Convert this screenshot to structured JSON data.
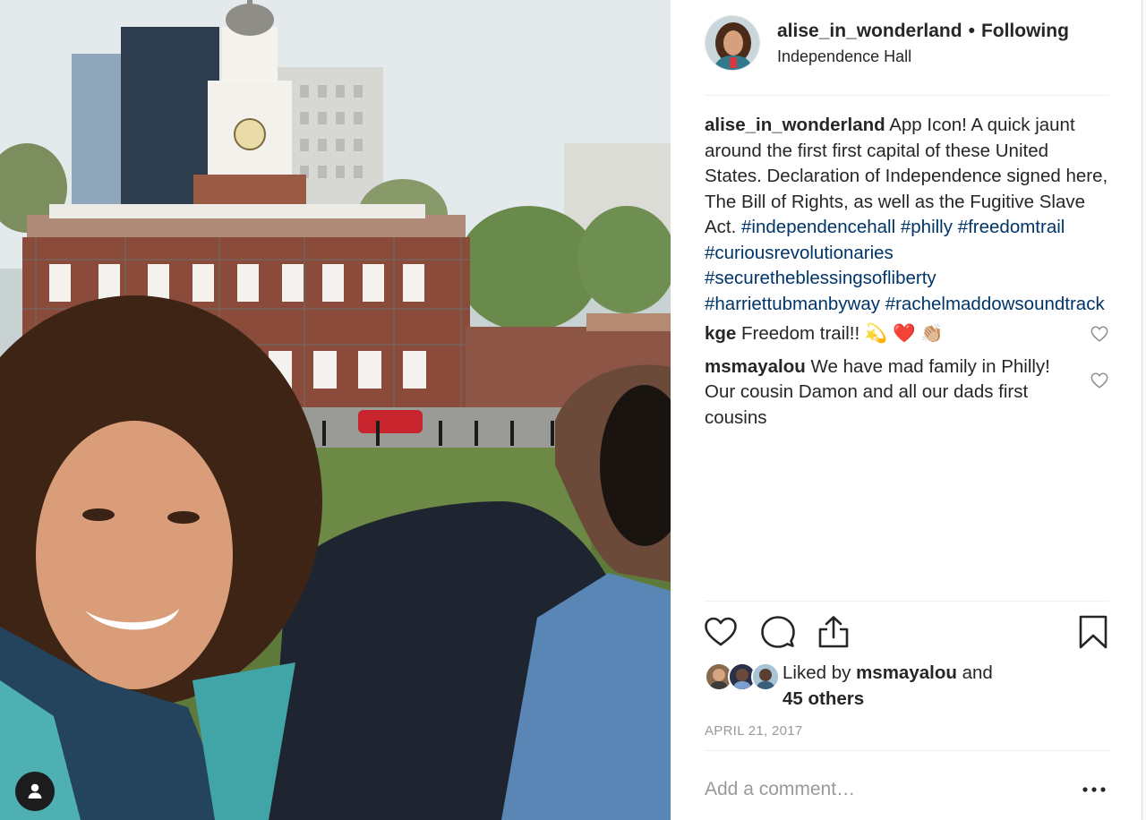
{
  "post": {
    "username": "alise_in_wonderland",
    "separator": "•",
    "follow_status": "Following",
    "location": "Independence Hall",
    "caption": {
      "username": "alise_in_wonderland",
      "text": "App Icon! A quick jaunt around the first first capital of these United States. Declaration of Independence signed here, The Bill of Rights, as well as the Fugitive Slave Act.",
      "hashtags": [
        "#independencehall",
        "#philly",
        "#freedomtrail",
        "#curiousrevolutionaries",
        "#securetheblessingsofliberty",
        "#harriettubmanbyway",
        "#rachelmaddowsoundtrack"
      ]
    },
    "comments": [
      {
        "username": "kge",
        "text": "Freedom trail!! 💫 ❤️ 👏🏼"
      },
      {
        "username": "msmayalou",
        "text": "We have mad family in Philly! Our cousin Damon and all our dads first cousins"
      }
    ],
    "likes": {
      "prefix": "Liked by",
      "liker": "msmayalou",
      "conjunction": "and",
      "others": "45 others"
    },
    "date": "APRIL 21, 2017",
    "add_comment_placeholder": "Add a comment…",
    "icons": {
      "like": "heart-icon",
      "comment": "comment-bubble-icon",
      "share": "share-icon",
      "save": "bookmark-icon",
      "more": "more-options-icon",
      "user_tag": "person-icon"
    }
  },
  "colors": {
    "text": "#262626",
    "hashtag": "#003569",
    "muted": "#999999",
    "border": "#efefef"
  }
}
